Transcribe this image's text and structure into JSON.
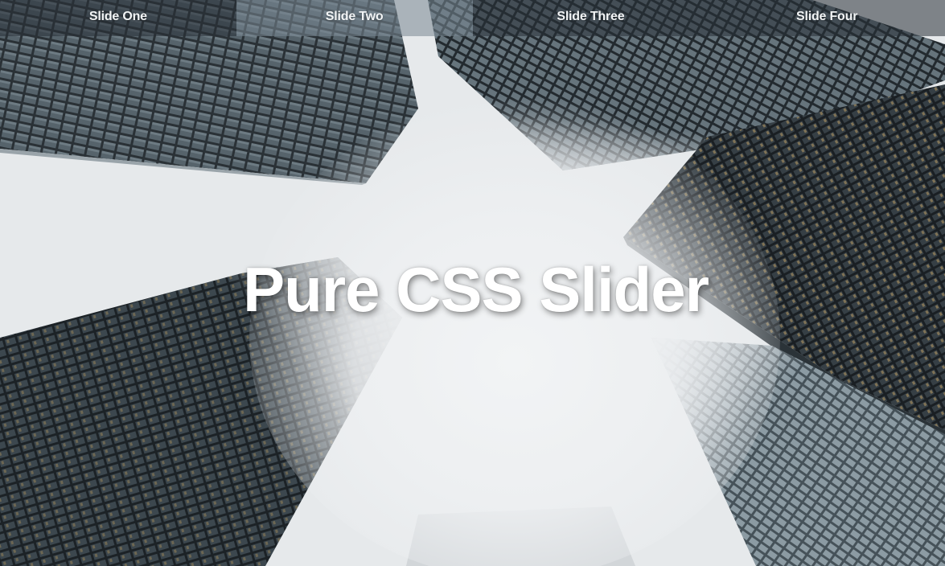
{
  "nav": {
    "tabs": [
      {
        "label": "Slide One"
      },
      {
        "label": "Slide Two"
      },
      {
        "label": "Slide Three"
      },
      {
        "label": "Slide Four"
      }
    ],
    "active_index": 1
  },
  "slide": {
    "title": "Pure CSS Slider",
    "image_icon": "skyscrapers-fog-photo"
  },
  "colors": {
    "nav_bg": "#283036",
    "title": "#ffffff",
    "sky": "#e9ecee"
  }
}
